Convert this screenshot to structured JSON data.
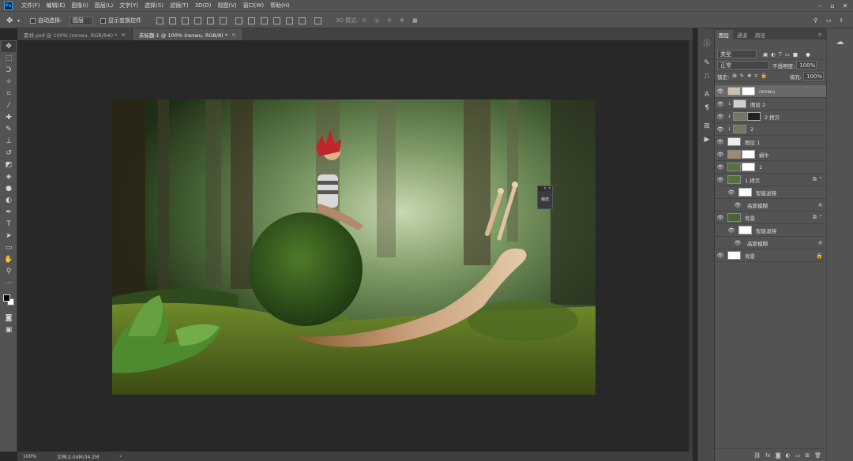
{
  "menu": {
    "logo": "Ps",
    "items": [
      "文件(F)",
      "编辑(E)",
      "图像(I)",
      "图层(L)",
      "文字(Y)",
      "选择(S)",
      "滤镜(T)",
      "3D(D)",
      "视图(V)",
      "窗口(W)",
      "帮助(H)"
    ]
  },
  "options": {
    "auto_select_label": "自动选择:",
    "auto_select_value": "图层",
    "show_transform_label": "显示变换控件",
    "mode_3d_label": "3D 模式:"
  },
  "tabs": [
    {
      "label": "素材.psd @ 100% (renwu, RGB/8#) *"
    },
    {
      "label": "未标题-1 @ 100% (renwu, RGB/8) *"
    }
  ],
  "canvas_popup": {
    "label": "缩放"
  },
  "status": {
    "zoom": "100%",
    "doc": "文档:2.04M/34.2M"
  },
  "panel": {
    "tabs": [
      "图层",
      "通道",
      "路径"
    ],
    "filter_kind": "类型",
    "blend_mode": "正常",
    "opacity_label": "不透明度:",
    "opacity_value": "100%",
    "lock_label": "锁定:",
    "fill_label": "填充:",
    "fill_value": "100%",
    "layers": [
      {
        "name": "renwu"
      },
      {
        "name": "图层 2"
      },
      {
        "name": "2 拷贝"
      },
      {
        "name": "2"
      },
      {
        "name": "图层 1"
      },
      {
        "name": "蜗牛"
      },
      {
        "name": "1"
      },
      {
        "name": "1 拷贝"
      },
      {
        "name": "智能滤镜"
      },
      {
        "name": "高斯模糊"
      },
      {
        "name": "背景"
      },
      {
        "name": "智能滤镜"
      },
      {
        "name": "高斯模糊"
      },
      {
        "name": "背景"
      }
    ]
  },
  "colors": {
    "foreground": "#000000",
    "background": "#ffffff",
    "accent": "#31a8ff"
  }
}
